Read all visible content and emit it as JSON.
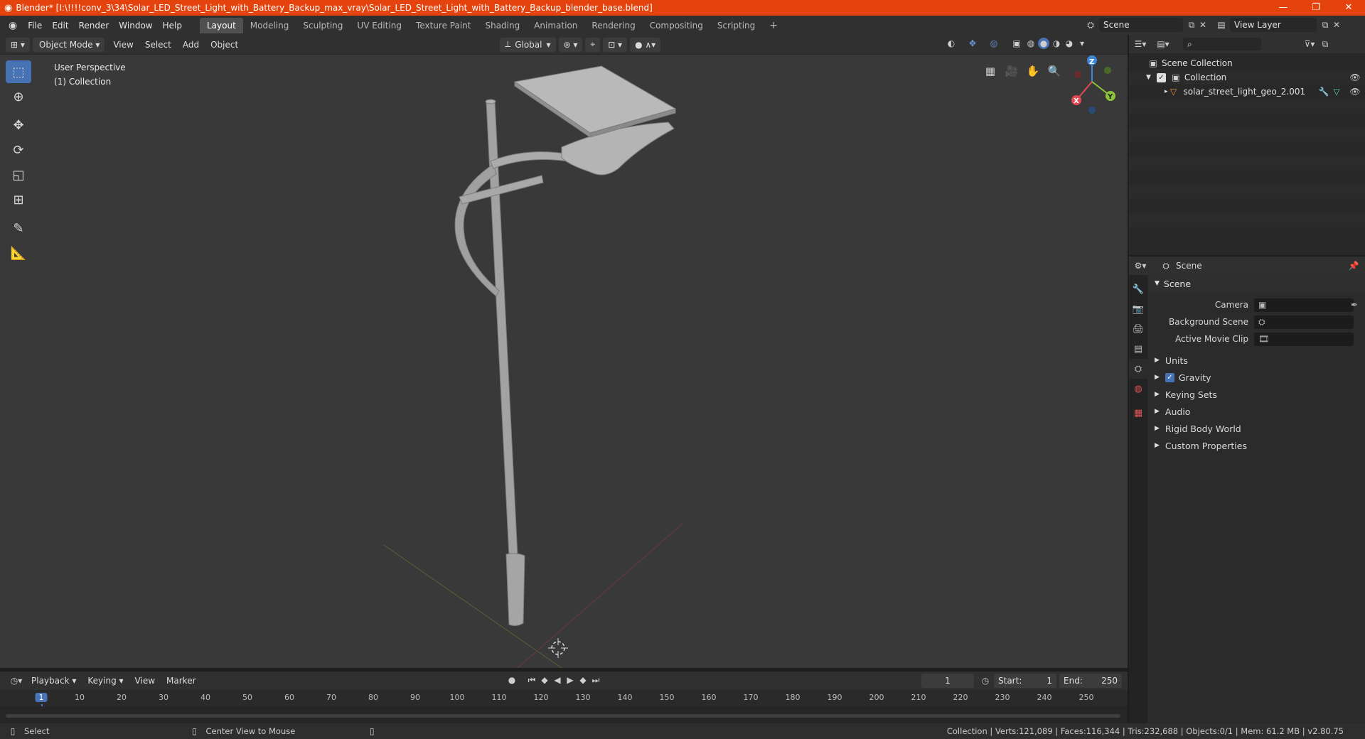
{
  "window": {
    "title": "Blender* [I:\\!!!!conv_3\\34\\Solar_LED_Street_Light_with_Battery_Backup_max_vray\\Solar_LED_Street_Light_with_Battery_Backup_blender_base.blend]",
    "minimize": "—",
    "restore": "❐",
    "close": "✕"
  },
  "menu": [
    "File",
    "Edit",
    "Render",
    "Window",
    "Help"
  ],
  "workspaces": [
    "Layout",
    "Modeling",
    "Sculpting",
    "UV Editing",
    "Texture Paint",
    "Shading",
    "Animation",
    "Rendering",
    "Compositing",
    "Scripting"
  ],
  "add_workspace": "+",
  "scene_field": "Scene",
  "view_layer_field": "View Layer",
  "viewport_header": {
    "mode": "Object Mode",
    "view": "View",
    "select": "Select",
    "add": "Add",
    "object": "Object",
    "orientation": "Global"
  },
  "viewport": {
    "perspective": "User Perspective",
    "collection": "(1) Collection",
    "axis_x": "X",
    "axis_y": "Y",
    "axis_z": "Z"
  },
  "outliner": {
    "root": "Scene Collection",
    "collection": "Collection",
    "object": "solar_street_light_geo_2.001"
  },
  "properties": {
    "header": "Scene",
    "section": "Scene",
    "camera_label": "Camera",
    "background_label": "Background Scene",
    "clip_label": "Active Movie Clip",
    "subsections": [
      "Units",
      "Gravity",
      "Keying Sets",
      "Audio",
      "Rigid Body World",
      "Custom Properties"
    ]
  },
  "timeline": {
    "playback": "Playback",
    "keying": "Keying",
    "view": "View",
    "marker": "Marker",
    "current_frame": "1",
    "start_label": "Start:",
    "start": "1",
    "end_label": "End:",
    "end": "250",
    "ticks": [
      "1",
      "10",
      "20",
      "30",
      "40",
      "50",
      "60",
      "70",
      "80",
      "90",
      "100",
      "110",
      "120",
      "130",
      "140",
      "150",
      "160",
      "170",
      "180",
      "190",
      "200",
      "210",
      "220",
      "230",
      "240",
      "250"
    ]
  },
  "status": {
    "select": "Select",
    "center": "Center View to Mouse",
    "stats": "Collection | Verts:121,089 | Faces:116,344 | Tris:232,688 | Objects:0/1 | Mem: 61.2 MB | v2.80.75"
  },
  "colors": {
    "accent": "#4772b3",
    "titlebar": "#e5430e",
    "x_axis": "#e34a53",
    "y_axis": "#8bc43a",
    "z_axis": "#3f87d8"
  },
  "icons": {
    "blender": "blender-logo-icon",
    "eye": "eye-icon",
    "search": "search-icon",
    "filter": "filter-icon"
  }
}
